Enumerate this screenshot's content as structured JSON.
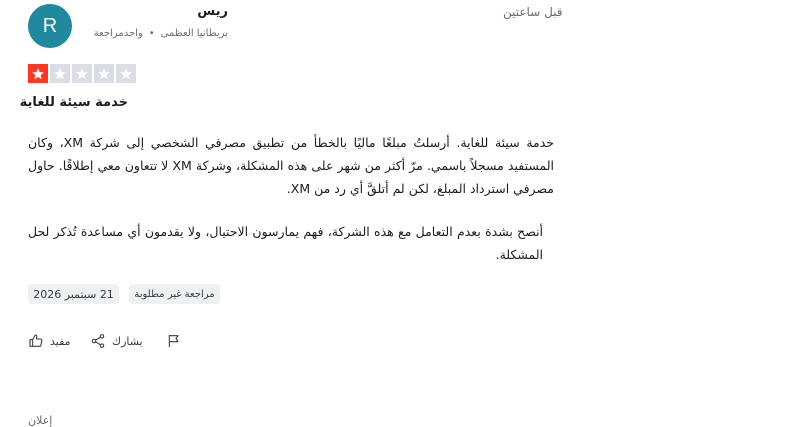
{
  "header": {
    "time": "قبل ساعتين",
    "user_name": "ريس",
    "user_reviews": "واحدمراجعة",
    "user_country": "بريطانيا العظمى",
    "avatar_letter": "R"
  },
  "rating": {
    "value": 1,
    "max": 5,
    "filled_color": "#ff3722",
    "empty_color": "#dcdce6"
  },
  "review": {
    "title": "خدمة سيئة للغاية",
    "paragraph1": "خدمة سيئة للغاية. أرسلتُ مبلغًا ماليًا بالخطأ من تطبيق مصرفي الشخصي إلى شركة XM، وكان المستفيد مسجلاً باسمي. مرّ أكثر من شهر على هذه المشكلة، وشركة XM لا تتعاون معي إطلاقًا. حاول مصرفي استرداد المبلغ، لكن لم أتلقَّ أي رد من XM.",
    "paragraph2": "أنصح بشدة بعدم التعامل مع هذه الشركة، فهم يمارسون الاحتيال، ولا يقدمون أي مساعدة تُذكر لحل المشكلة."
  },
  "tags": {
    "date": "21 سبتمبر 2026",
    "type": "مراجعة غير مطلوبة"
  },
  "actions": {
    "useful": "مفيد",
    "share": "يشارك"
  },
  "footer": {
    "partial_text": "إعلان"
  },
  "colors": {
    "avatar_bg": "#1f8a9f"
  }
}
